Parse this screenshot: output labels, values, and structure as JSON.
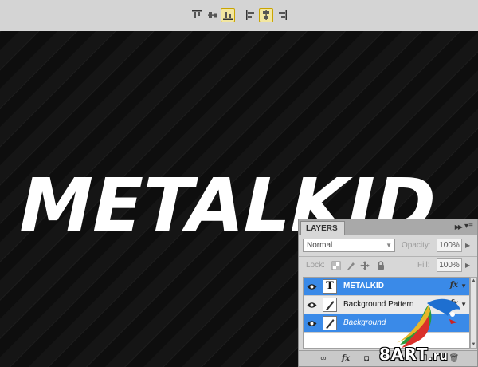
{
  "options_bar": {
    "buttons": [
      {
        "icon": "align-top-edges-icon",
        "active": false
      },
      {
        "icon": "align-vertical-centers-icon",
        "active": false
      },
      {
        "icon": "align-bottom-edges-icon",
        "active": true
      },
      {
        "icon": "align-left-edges-icon",
        "active": false
      },
      {
        "icon": "align-horizontal-centers-icon",
        "active": true
      },
      {
        "icon": "align-right-edges-icon",
        "active": false
      }
    ]
  },
  "canvas": {
    "logo_text": "METALKID",
    "background_color": "#111111",
    "text_color": "#ffffff"
  },
  "layers_panel": {
    "tab_label": "LAYERS",
    "blend_mode": "Normal",
    "opacity_label": "Opacity:",
    "opacity_value": "100%",
    "lock_label": "Lock:",
    "fill_label": "Fill:",
    "fill_value": "100%",
    "layers": [
      {
        "name": "METALKID",
        "kind": "text",
        "selected": true,
        "fx": "fx"
      },
      {
        "name": "Background Pattern",
        "kind": "brush",
        "selected": false,
        "fx": "fx"
      },
      {
        "name": "Background",
        "kind": "brush",
        "selected": true,
        "fx": ""
      }
    ],
    "selection_color": "#3a8ae8"
  },
  "watermark": {
    "text": "8ART",
    "suffix": ".ru"
  }
}
